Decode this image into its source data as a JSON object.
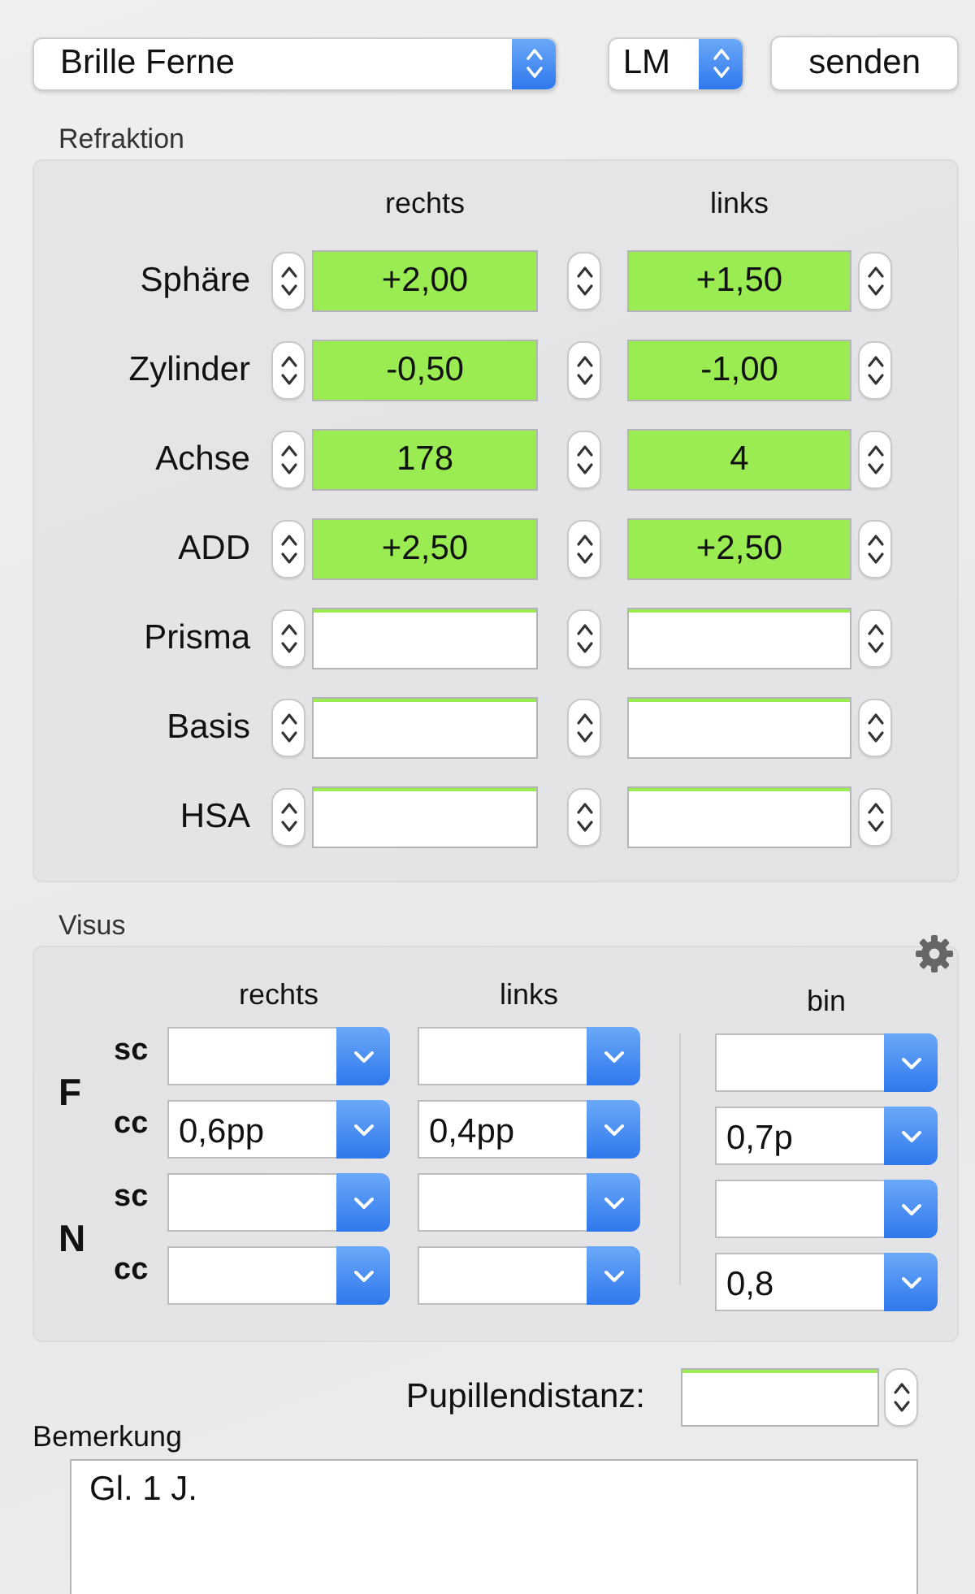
{
  "profile_select": {
    "value": "Brille Ferne"
  },
  "mode_select": {
    "value": "LM"
  },
  "send_button": {
    "label": "senden"
  },
  "refraktion": {
    "title": "Refraktion",
    "columns": [
      "rechts",
      "links"
    ],
    "rows": [
      {
        "label": "Sphäre",
        "right": {
          "value": "+2,00",
          "highlighted": true
        },
        "left": {
          "value": "+1,50",
          "highlighted": true
        }
      },
      {
        "label": "Zylinder",
        "right": {
          "value": "-0,50",
          "highlighted": true
        },
        "left": {
          "value": "-1,00",
          "highlighted": true
        }
      },
      {
        "label": "Achse",
        "right": {
          "value": "178",
          "highlighted": true
        },
        "left": {
          "value": "4",
          "highlighted": true
        }
      },
      {
        "label": "ADD",
        "right": {
          "value": "+2,50",
          "highlighted": true
        },
        "left": {
          "value": "+2,50",
          "highlighted": true
        }
      },
      {
        "label": "Prisma",
        "right": {
          "highlighted": false
        },
        "left": {
          "highlighted": false
        }
      },
      {
        "label": "Basis",
        "right": {
          "highlighted": false
        },
        "left": {
          "highlighted": false
        }
      },
      {
        "label": "HSA",
        "right": {
          "highlighted": false
        },
        "left": {
          "highlighted": false
        }
      }
    ]
  },
  "visus": {
    "title": "Visus",
    "columns": [
      "rechts",
      "links",
      "bin"
    ],
    "groups": [
      {
        "label": "F",
        "rows": [
          {
            "label": "sc"
          },
          {
            "label": "cc",
            "right": "0,6pp",
            "left": "0,4pp",
            "bin": "0,7p"
          }
        ]
      },
      {
        "label": "N",
        "rows": [
          {
            "label": "sc"
          },
          {
            "label": "cc",
            "bin": "0,8"
          }
        ]
      }
    ]
  },
  "pupillendistanz": {
    "label": "Pupillendistanz:",
    "highlighted": false
  },
  "bemerkung": {
    "label": "Bemerkung",
    "value": "Gl. 1 J."
  }
}
